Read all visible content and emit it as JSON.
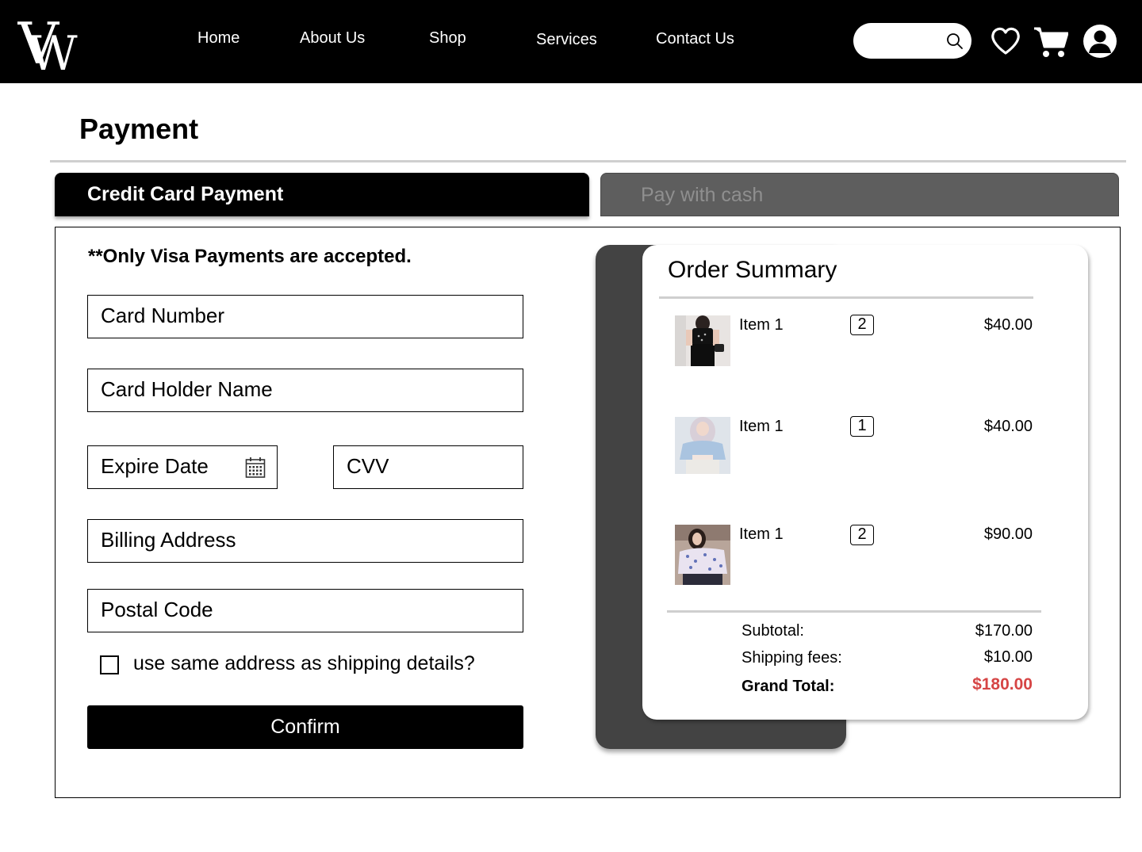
{
  "header": {
    "logo_text": "VW",
    "nav": {
      "home": "Home",
      "about": "About Us",
      "shop": "Shop",
      "services": "Services",
      "contact": "Contact Us"
    },
    "search_placeholder": "",
    "icons": [
      "search-icon",
      "heart-icon",
      "cart-icon",
      "user-icon"
    ]
  },
  "page": {
    "title": "Payment"
  },
  "tabs": {
    "credit_card": "Credit Card Payment",
    "cash": "Pay with cash",
    "active": "credit_card"
  },
  "form": {
    "note": "**Only Visa Payments are accepted.",
    "card_number": "Card Number",
    "card_holder": "Card Holder Name",
    "expire_date": "Expire Date",
    "cvv": "CVV",
    "billing_address": "Billing Address",
    "postal_code": "Postal Code",
    "same_address_label": "use same address as shipping details?",
    "same_address_checked": false,
    "confirm": "Confirm"
  },
  "order_summary": {
    "title": "Order Summary",
    "items": [
      {
        "name": "Item 1",
        "qty": "2",
        "price": "$40.00"
      },
      {
        "name": "Item 1",
        "qty": "1",
        "price": "$40.00"
      },
      {
        "name": "Item 1",
        "qty": "2",
        "price": "$90.00"
      }
    ],
    "subtotal_label": "Subtotal:",
    "subtotal": "$170.00",
    "shipping_label": "Shipping fees:",
    "shipping": "$10.00",
    "grand_total_label": "Grand Total:",
    "grand_total": "$180.00"
  },
  "colors": {
    "header_bg": "#000000",
    "tab_inactive": "#5e5e5e",
    "summary_shadow_panel": "#434343",
    "grand_total": "#d64545"
  }
}
